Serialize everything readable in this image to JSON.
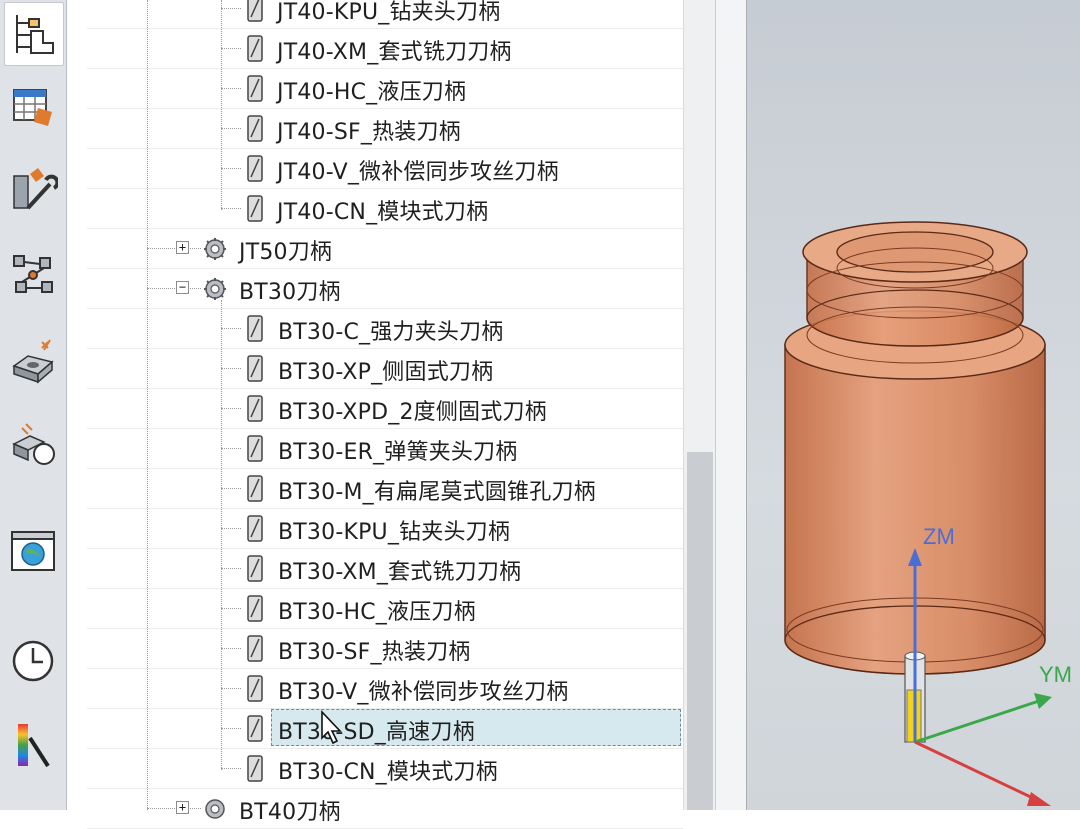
{
  "tree": {
    "rows": [
      {
        "kind": "item",
        "label": "JT40-KPU_钻夹头刀柄"
      },
      {
        "kind": "item",
        "label": "JT40-XM_套式铣刀刀柄"
      },
      {
        "kind": "item",
        "label": "JT40-HC_液压刀柄"
      },
      {
        "kind": "item",
        "label": "JT40-SF_热装刀柄"
      },
      {
        "kind": "item",
        "label": "JT40-V_微补偿同步攻丝刀柄"
      },
      {
        "kind": "item",
        "label": "JT40-CN_模块式刀柄"
      },
      {
        "kind": "group",
        "label": "JT50刀柄",
        "expander": "+"
      },
      {
        "kind": "group",
        "label": "BT30刀柄",
        "expander": "−"
      },
      {
        "kind": "item",
        "label": "BT30-C_强力夹头刀柄"
      },
      {
        "kind": "item",
        "label": "BT30-XP_侧固式刀柄"
      },
      {
        "kind": "item",
        "label": "BT30-XPD_2度侧固式刀柄"
      },
      {
        "kind": "item",
        "label": "BT30-ER_弹簧夹头刀柄"
      },
      {
        "kind": "item",
        "label": "BT30-M_有扁尾莫式圆锥孔刀柄"
      },
      {
        "kind": "item",
        "label": "BT30-KPU_钻夹头刀柄"
      },
      {
        "kind": "item",
        "label": "BT30-XM_套式铣刀刀柄"
      },
      {
        "kind": "item",
        "label": "BT30-HC_液压刀柄"
      },
      {
        "kind": "item",
        "label": "BT30-SF_热装刀柄"
      },
      {
        "kind": "item",
        "label": "BT30-V_微补偿同步攻丝刀柄"
      },
      {
        "kind": "item",
        "label": "BT30-SD_高速刀柄",
        "selected": true
      },
      {
        "kind": "item",
        "label": "BT30-CN_模块式刀柄"
      },
      {
        "kind": "group",
        "label": "BT40刀柄",
        "expander": "+"
      }
    ]
  },
  "toolbar": {
    "buttons": [
      {
        "name": "assembly-navigator-icon",
        "active": true
      },
      {
        "name": "spreadsheet-icon"
      },
      {
        "name": "tools-icon"
      },
      {
        "name": "constraint-navigator-icon"
      },
      {
        "name": "part-feature-icon"
      },
      {
        "name": "shape-measure-icon"
      },
      {
        "name": "web-browser-icon"
      },
      {
        "name": "history-clock-icon"
      },
      {
        "name": "color-palette-icon"
      }
    ]
  },
  "viewport": {
    "axes": {
      "z": "ZM",
      "y": "YM"
    },
    "colors": {
      "z_axis": "#4a6fd4",
      "y_axis": "#3aa84a",
      "x_axis": "#d64040",
      "model": "#d98a62"
    }
  }
}
